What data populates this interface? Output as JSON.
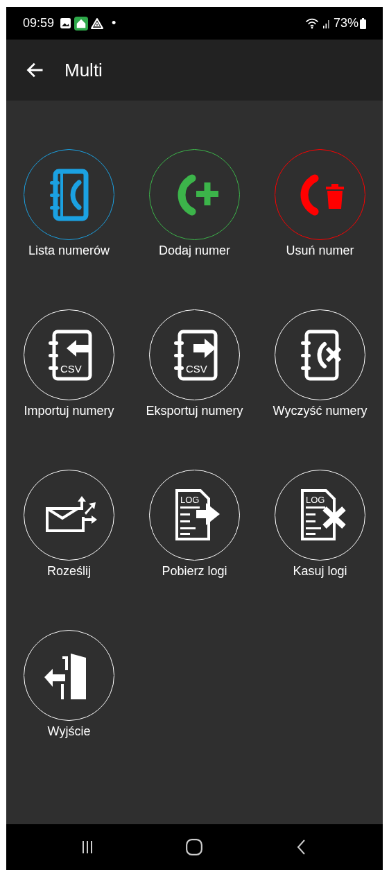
{
  "status_bar": {
    "time": "09:59",
    "dot": "•",
    "battery": "73%"
  },
  "app_bar": {
    "title": "Multi"
  },
  "tiles": [
    {
      "label": "Lista numerów",
      "kind": "phonebook",
      "color": "#1ba1e2"
    },
    {
      "label": "Dodaj numer",
      "kind": "phone-add",
      "color": "#3cb44a"
    },
    {
      "label": "Usuń numer",
      "kind": "phone-delete",
      "color": "#ff0000"
    },
    {
      "label": "Importuj numery",
      "kind": "import-csv",
      "color": "#ffffff",
      "badge": "CSV"
    },
    {
      "label": "Eksportuj numery",
      "kind": "export-csv",
      "color": "#ffffff",
      "badge": "CSV"
    },
    {
      "label": "Wyczyść numery",
      "kind": "clear-book",
      "color": "#ffffff"
    },
    {
      "label": "Roześlij",
      "kind": "broadcast",
      "color": "#ffffff"
    },
    {
      "label": "Pobierz logi",
      "kind": "log-download",
      "color": "#ffffff",
      "badge": "LOG"
    },
    {
      "label": "Kasuj logi",
      "kind": "log-delete",
      "color": "#ffffff",
      "badge": "LOG"
    },
    {
      "label": "Wyjście",
      "kind": "exit",
      "color": "#ffffff"
    }
  ]
}
